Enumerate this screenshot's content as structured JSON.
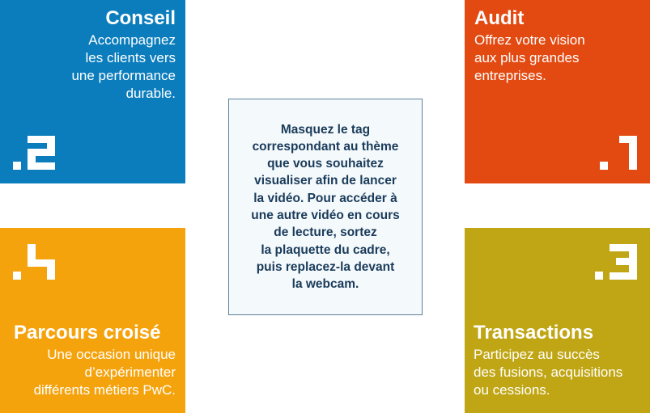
{
  "tiles": {
    "conseil": {
      "number": ".2",
      "title": "Conseil",
      "description_lines": [
        "Accompagnez",
        "les clients vers",
        "une performance",
        "durable."
      ],
      "color": "#0b7dbd"
    },
    "audit": {
      "number": ".1",
      "title": "Audit",
      "description_lines": [
        "Offrez votre vision",
        "aux plus grandes",
        "entreprises."
      ],
      "color": "#e34a12"
    },
    "parcours": {
      "number": ".4",
      "title": "Parcours croisé",
      "description_lines": [
        "Une occasion unique",
        "d’expérimenter",
        "différents métiers PwC."
      ],
      "color": "#f5a30d"
    },
    "transactions": {
      "number": ".3",
      "title": "Transactions",
      "description_lines": [
        "Participez au succès",
        "des fusions, acquisitions",
        "ou cessions."
      ],
      "color": "#c0a614"
    }
  },
  "instructions": {
    "lines": [
      "Masquez le tag",
      "correspondant au thème",
      "que vous souhaitez",
      "visualiser afin de lancer",
      "la vidéo. Pour accéder à",
      "une autre vidéo en cours",
      "de lecture, sortez",
      "la plaquette du cadre,",
      "puis replacez-la devant",
      "la webcam."
    ],
    "text_color": "#1a3b5a",
    "border_color": "#5d7f99",
    "background": "#f4f9fc"
  }
}
